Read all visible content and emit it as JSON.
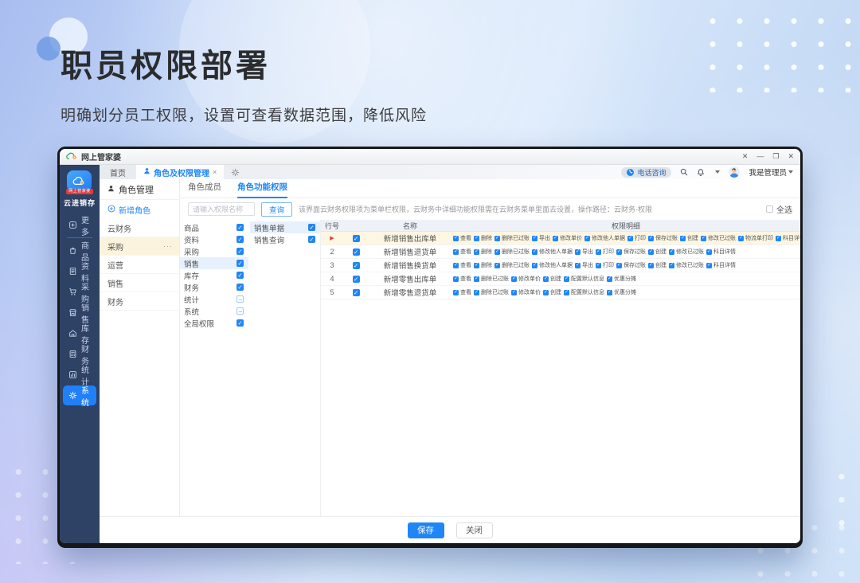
{
  "hero": {
    "title": "职员权限部署",
    "subtitle": "明确划分员工权限，设置可查看数据范围，降低风险"
  },
  "window": {
    "title": "网上管家婆",
    "control_glyphs": [
      "✕",
      "—",
      "❐",
      "✕"
    ]
  },
  "sidebar": {
    "logo_badge": "网上管家婆",
    "logo_label": "云进销存",
    "items": [
      {
        "key": "more",
        "label": "更多",
        "divider_after": true
      },
      {
        "key": "goods",
        "label": "商品"
      },
      {
        "key": "data",
        "label": "资料"
      },
      {
        "key": "purchase",
        "label": "采购"
      },
      {
        "key": "sales",
        "label": "销售"
      },
      {
        "key": "stock",
        "label": "库存"
      },
      {
        "key": "finance",
        "label": "财务"
      },
      {
        "key": "stats",
        "label": "统计"
      },
      {
        "key": "system",
        "label": "系统",
        "active": true
      }
    ]
  },
  "tabbar": {
    "tabs": [
      {
        "key": "home",
        "label": "首页"
      },
      {
        "key": "role-permission",
        "label": "角色及权限管理",
        "active": true,
        "closable": true,
        "close_glyph": "×"
      }
    ]
  },
  "toolbar": {
    "phone_label": "电话咨询",
    "user_label": "我是管理员"
  },
  "role_panel": {
    "title": "角色管理",
    "add_label": "新增角色",
    "roles": [
      {
        "name": "云财务"
      },
      {
        "name": "采购",
        "active": true,
        "menu_glyph": "···"
      },
      {
        "name": "运营"
      },
      {
        "name": "销售"
      },
      {
        "name": "财务"
      }
    ]
  },
  "perm_panel": {
    "tabs": [
      {
        "key": "role-members",
        "label": "角色成员"
      },
      {
        "key": "role-function-perms",
        "label": "角色功能权限",
        "active": true
      }
    ],
    "search_placeholder": "请输入权限名称",
    "query_label": "查询",
    "hint": "该界面云财务权限项为菜单栏权限，云财务中详细功能权限需在云财务菜单里面去设置，操作路径：云财务-权限",
    "select_all_label": "全选",
    "modules": [
      {
        "label": "商品",
        "state": "checked"
      },
      {
        "label": "资料",
        "state": "checked"
      },
      {
        "label": "采购",
        "state": "checked"
      },
      {
        "label": "销售",
        "state": "checked",
        "active": true
      },
      {
        "label": "库存",
        "state": "checked"
      },
      {
        "label": "财务",
        "state": "checked"
      },
      {
        "label": "统计",
        "state": "indeterminate"
      },
      {
        "label": "系统",
        "state": "indeterminate"
      },
      {
        "label": "全局权限",
        "state": "checked"
      }
    ],
    "submodules": [
      {
        "label": "销售单据",
        "state": "checked",
        "active": true
      },
      {
        "label": "销售查询",
        "state": "checked"
      }
    ],
    "table": {
      "headers": {
        "row_no": "行号",
        "name": "名称",
        "perms": "权限明细"
      },
      "rows": [
        {
          "row_no": "▶",
          "marker": true,
          "checked": true,
          "highlight": true,
          "name": "新增销售出库单",
          "perms": [
            "查看",
            "删除",
            "删除已过账",
            "导出",
            "修改单价",
            "修改他人单据",
            "打印",
            "保存过账",
            "创建",
            "修改已过账",
            "物流单打印",
            "科目详情"
          ]
        },
        {
          "row_no": "2",
          "checked": true,
          "name": "新增销售退货单",
          "perms": [
            "查看",
            "删除",
            "删除已过账",
            "修改他人单据",
            "导出",
            "打印",
            "保存过账",
            "创建",
            "修改已过账",
            "科目详情"
          ]
        },
        {
          "row_no": "3",
          "checked": true,
          "name": "新增销售换货单",
          "perms": [
            "查看",
            "删除",
            "删除已过账",
            "修改他人单据",
            "导出",
            "打印",
            "保存过账",
            "创建",
            "修改已过账",
            "科目详情"
          ]
        },
        {
          "row_no": "4",
          "checked": true,
          "name": "新增零售出库单",
          "perms": [
            "查看",
            "删除已过账",
            "修改单价",
            "创建",
            "配置默认信息",
            "优惠分摊"
          ]
        },
        {
          "row_no": "5",
          "checked": true,
          "name": "新增零售退货单",
          "perms": [
            "查看",
            "删除已过账",
            "修改单价",
            "创建",
            "配置默认信息",
            "优惠分摊"
          ]
        }
      ]
    }
  },
  "footer": {
    "save_label": "保存",
    "close_label": "关闭"
  },
  "colors": {
    "accent": "#2086f7",
    "sidebar": "#2e4266",
    "badge_red": "#e23b3b",
    "row_highlight_yellow": "#fdf6e2",
    "row_highlight_blue": "#e7f1fd"
  }
}
